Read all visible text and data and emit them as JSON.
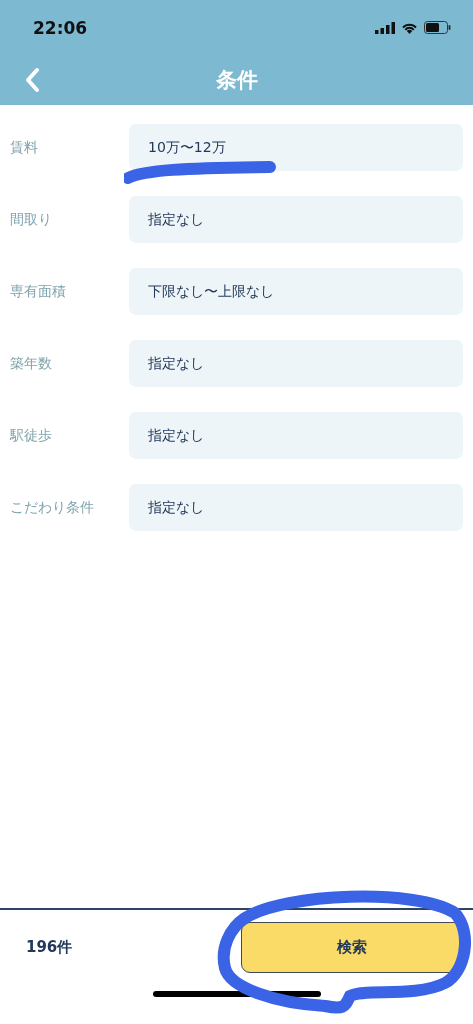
{
  "status_bar": {
    "time": "22:06"
  },
  "nav": {
    "title": "条件"
  },
  "conditions": [
    {
      "label": "賃料",
      "value": "10万〜12万"
    },
    {
      "label": "間取り",
      "value": "指定なし"
    },
    {
      "label": "専有面積",
      "value": "下限なし〜上限なし"
    },
    {
      "label": "築年数",
      "value": "指定なし"
    },
    {
      "label": "駅徒歩",
      "value": "指定なし"
    },
    {
      "label": "こだわり条件",
      "value": "指定なし"
    }
  ],
  "footer": {
    "count": "196件",
    "button": "検索"
  }
}
